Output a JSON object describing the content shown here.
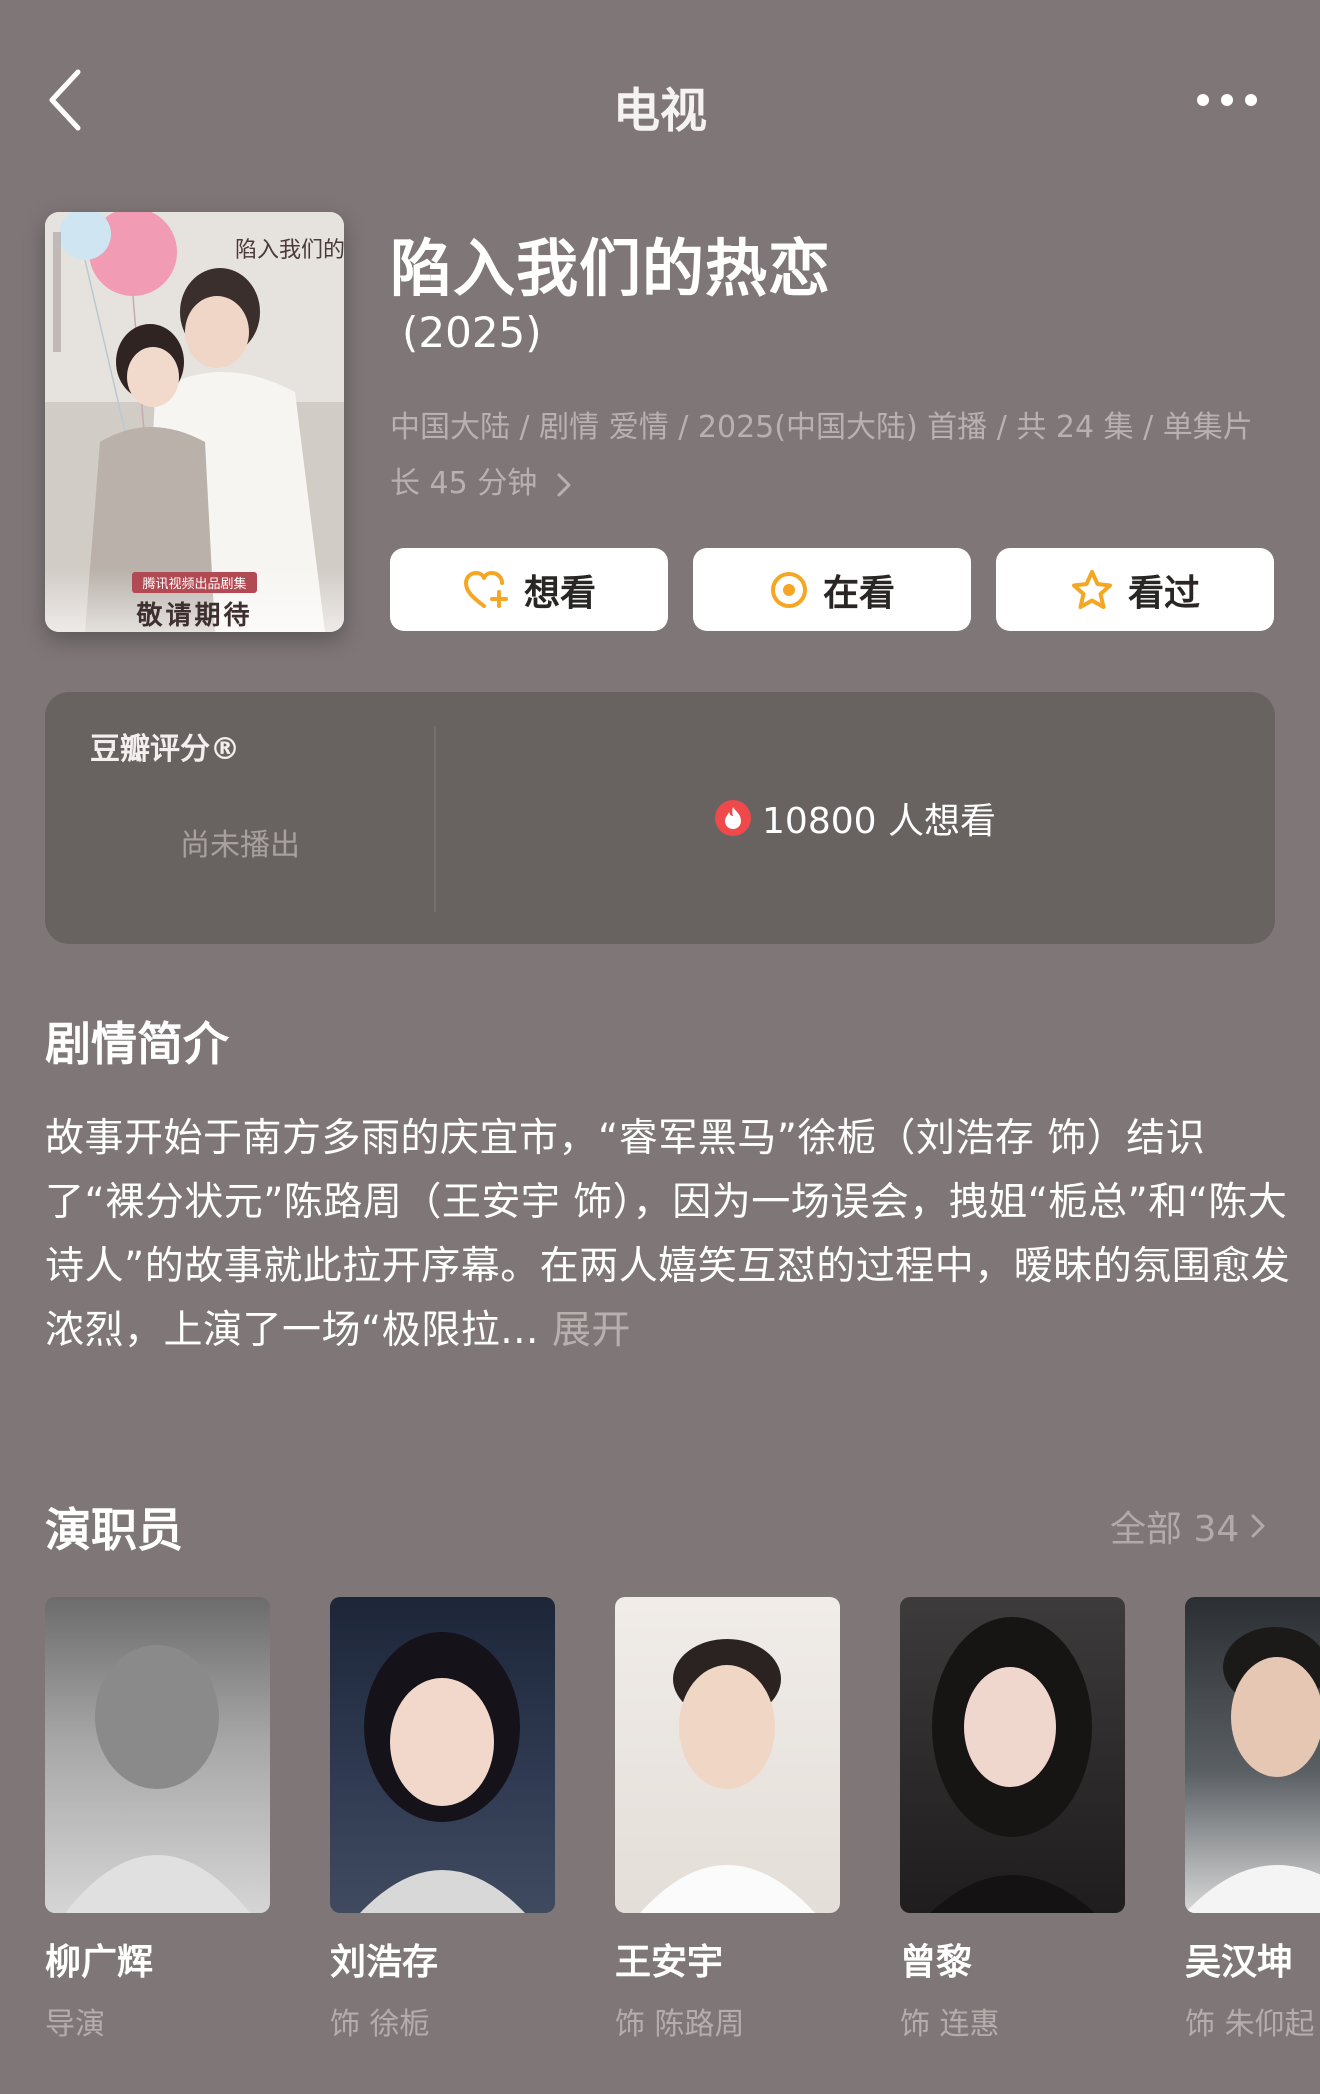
{
  "header": {
    "title": "电视",
    "back_icon": "chevron-left-icon",
    "more_icon": "ellipsis-icon"
  },
  "poster": {
    "calligraphy": "陷入我们的热恋",
    "tag": "腾讯视频出品剧集",
    "slogan": "敬请期待"
  },
  "movie": {
    "title": "陷入我们的热恋",
    "year": "(2025)",
    "meta": "中国大陆 / 剧情 爱情 / 2025(中国大陆) 首播 / 共 24 集 / 单集片长 45 分钟"
  },
  "actions": {
    "want": {
      "label": "想看",
      "icon": "heart-plus-icon"
    },
    "watching": {
      "label": "在看",
      "icon": "target-icon"
    },
    "watched": {
      "label": "看过",
      "icon": "star-icon"
    }
  },
  "rating": {
    "label": "豆瓣评分®",
    "status": "尚未播出",
    "want_count_text": "10800 人想看",
    "fire_icon": "fire-icon"
  },
  "synopsis": {
    "title": "剧情简介",
    "text": "故事开始于南方多雨的庆宜市，“睿军黑马”徐栀（刘浩存 饰）结识了“裸分状元”陈路周（王安宇 饰），因为一场误会，拽姐“栀总”和“陈大诗人”的故事就此拉开序幕。在两人嬉笑互怼的过程中，暧昧的氛围愈发浓烈，上演了一场“极限拉...",
    "expand": "展开"
  },
  "cast": {
    "title": "演职员",
    "all_label": "全部 34",
    "members": [
      {
        "name": "柳广辉",
        "role": "导演"
      },
      {
        "name": "刘浩存",
        "role": "饰 徐栀"
      },
      {
        "name": "王安宇",
        "role": "饰 陈路周"
      },
      {
        "name": "曾黎",
        "role": "饰 连惠"
      },
      {
        "name": "吴汉坤",
        "role": "饰 朱仰起"
      }
    ]
  },
  "colors": {
    "background": "#7f7777",
    "card": "#686261",
    "accent_orange": "#f5a623",
    "fire_red": "#f0494b"
  }
}
